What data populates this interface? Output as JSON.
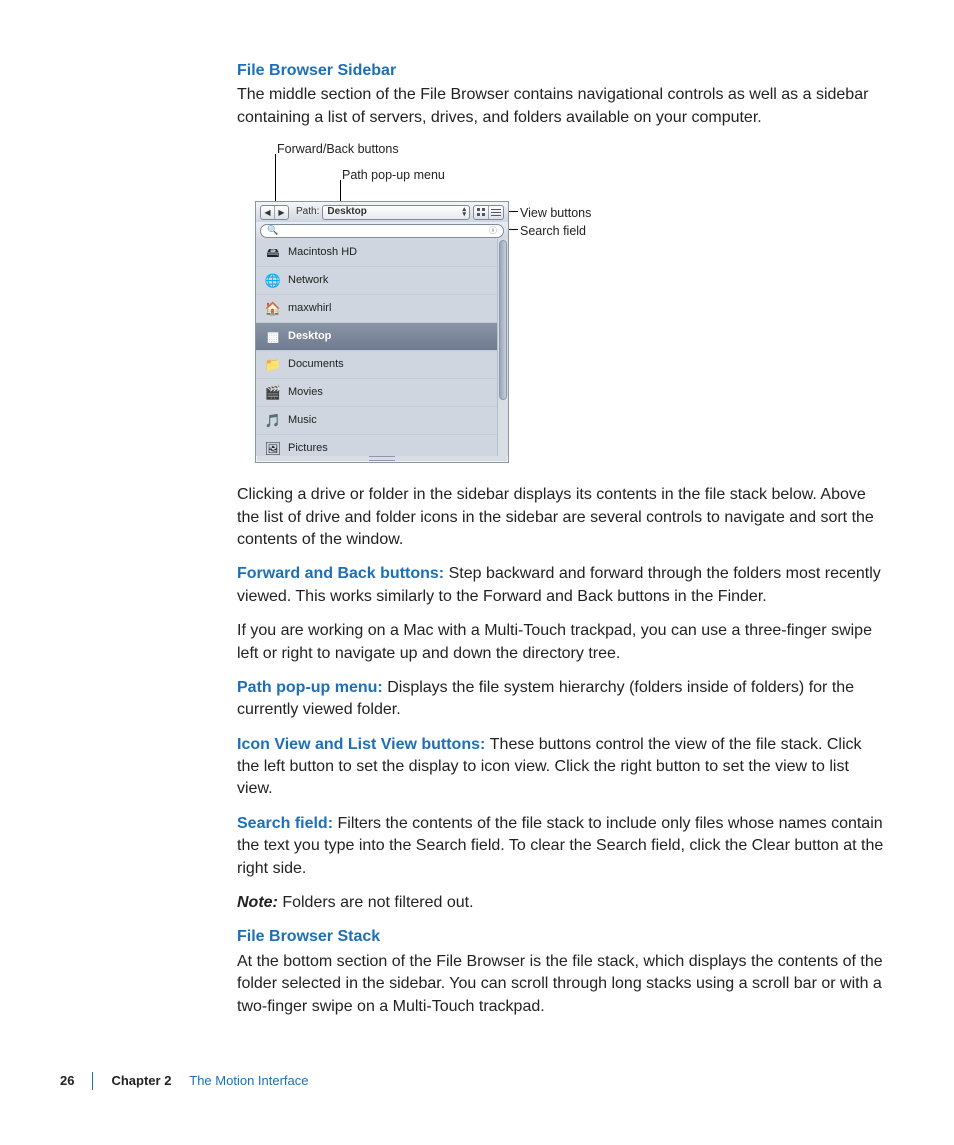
{
  "section1": {
    "heading": "File Browser Sidebar",
    "intro": "The middle section of the File Browser contains navigational controls as well as a sidebar containing a list of servers, drives, and folders available on your computer."
  },
  "figure": {
    "callouts": {
      "forward_back": "Forward/Back buttons",
      "path_popup": "Path pop-up menu",
      "view_buttons": "View buttons",
      "search_field": "Search field"
    },
    "toolbar": {
      "path_label": "Path:",
      "path_value": "Desktop"
    },
    "sidebar_items": [
      {
        "label": "Macintosh HD",
        "icon": "🖴"
      },
      {
        "label": "Network",
        "icon": "🌐"
      },
      {
        "label": "maxwhirl",
        "icon": "🏠"
      },
      {
        "label": "Desktop",
        "icon": "▦"
      },
      {
        "label": "Documents",
        "icon": "📁"
      },
      {
        "label": "Movies",
        "icon": "🎬"
      },
      {
        "label": "Music",
        "icon": "🎵"
      },
      {
        "label": "Pictures",
        "icon": "🖼"
      }
    ]
  },
  "body": {
    "p_after_figure": "Clicking a drive or folder in the sidebar displays its contents in the file stack below. Above the list of drive and folder icons in the sidebar are several controls to navigate and sort the contents of the window.",
    "forward_back": {
      "term": "Forward and Back buttons:  ",
      "text": "Step backward and forward through the folders most recently viewed. This works similarly to the Forward and Back buttons in the Finder."
    },
    "multitouch_nav": "If you are working on a Mac with a Multi-Touch trackpad, you can use a three-finger swipe left or right to navigate up and down the directory tree.",
    "path_popup": {
      "term": "Path pop-up menu:  ",
      "text": "Displays the file system hierarchy (folders inside of folders) for the currently viewed folder."
    },
    "view_buttons": {
      "term": "Icon View and List View buttons:  ",
      "text": "These buttons control the view of the file stack. Click the left button to set the display to icon view. Click the right button to set the view to list view."
    },
    "search_field": {
      "term": "Search field:  ",
      "text": "Filters the contents of the file stack to include only files whose names contain the text you type into the Search field. To clear the Search field, click the Clear button at the right side."
    },
    "note": {
      "label": "Note:  ",
      "text": "Folders are not filtered out."
    }
  },
  "section2": {
    "heading": "File Browser Stack",
    "text": "At the bottom section of the File Browser is the file stack, which displays the contents of the folder selected in the sidebar. You can scroll through long stacks using a scroll bar or with a two-finger swipe on a Multi-Touch trackpad."
  },
  "footer": {
    "page": "26",
    "chapter_label": "Chapter 2",
    "chapter_title": "The Motion Interface"
  }
}
